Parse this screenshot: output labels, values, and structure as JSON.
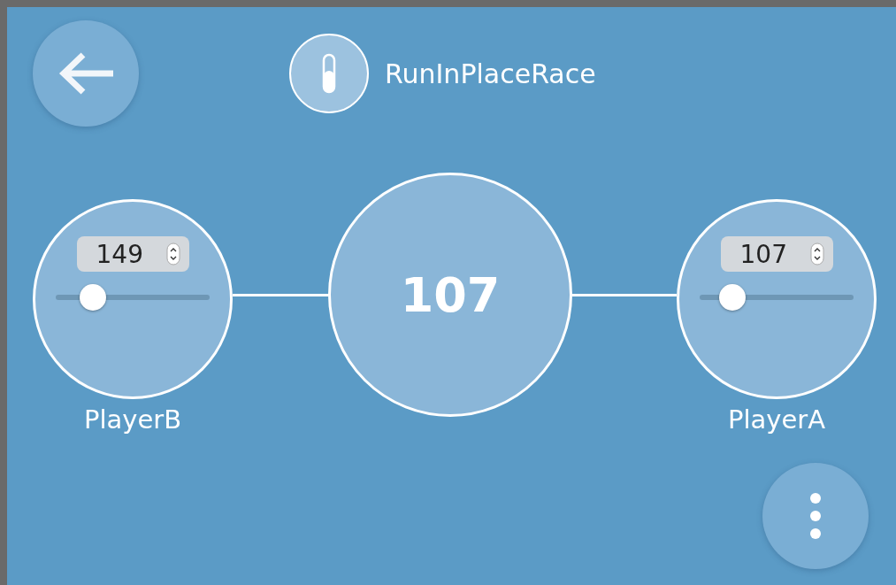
{
  "header": {
    "title": "RunInPlaceRace"
  },
  "center": {
    "value": "107"
  },
  "players": [
    {
      "name": "PlayerB",
      "value": "149",
      "level": 0.24
    },
    {
      "name": "PlayerA",
      "value": "107",
      "level": 0.21
    }
  ]
}
